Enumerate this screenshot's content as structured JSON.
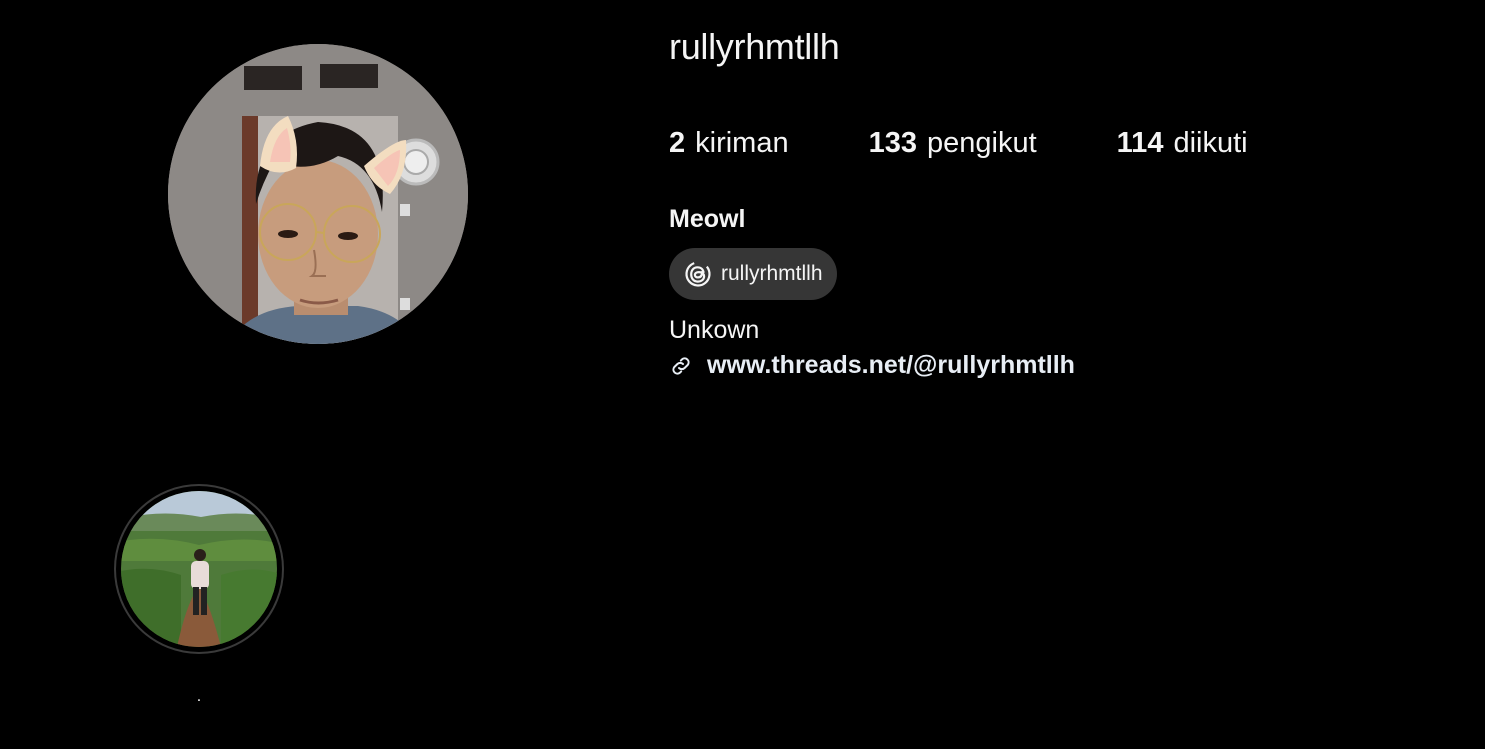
{
  "profile": {
    "username": "rullyrhmtllh",
    "full_name": "Meowl",
    "bio": "Unkown",
    "threads_badge_label": "rullyrhmtllh",
    "link_text": "www.threads.net/@rullyrhmtllh"
  },
  "stats": [
    {
      "count": "2",
      "label": "kiriman"
    },
    {
      "count": "133",
      "label": "pengikut"
    },
    {
      "count": "114",
      "label": "diikuti"
    }
  ],
  "highlights": [
    {
      "label": "."
    }
  ],
  "colors": {
    "background": "#000000",
    "text": "#f5f5f5",
    "pill_background": "#363636"
  }
}
